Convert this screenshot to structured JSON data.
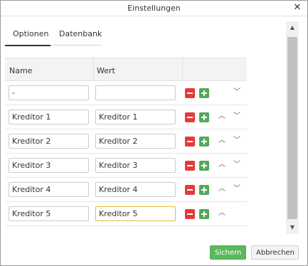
{
  "window": {
    "title": "Einstellungen",
    "close_glyph": "✕"
  },
  "tabs": [
    {
      "label": "Optionen",
      "active": true
    },
    {
      "label": "Datenbank",
      "active": false
    }
  ],
  "table": {
    "headers": {
      "name": "Name",
      "value": "Wert"
    },
    "rows": [
      {
        "name": "-",
        "value": "",
        "show_up": false,
        "show_down": true
      },
      {
        "name": "Kreditor 1",
        "value": "Kreditor 1",
        "show_up": true,
        "show_down": true
      },
      {
        "name": "Kreditor 2",
        "value": "Kreditor 2",
        "show_up": true,
        "show_down": true
      },
      {
        "name": "Kreditor 3",
        "value": "Kreditor 3",
        "show_up": true,
        "show_down": true
      },
      {
        "name": "Kreditor 4",
        "value": "Kreditor 4",
        "show_up": true,
        "show_down": true
      },
      {
        "name": "Kreditor 5",
        "value": "Kreditor 5",
        "show_up": true,
        "show_down": false,
        "value_focused": true
      }
    ],
    "arrow_up_glyph": "︿",
    "arrow_down_glyph": "﹀"
  },
  "scrollbar": {
    "up_glyph": "▲",
    "down_glyph": "▼"
  },
  "footer": {
    "save_label": "Sichern",
    "cancel_label": "Abbrechen"
  },
  "colors": {
    "remove": "#e53a3a",
    "add": "#55a85a",
    "save": "#5cb85c",
    "focus_border": "#e8b93c"
  }
}
